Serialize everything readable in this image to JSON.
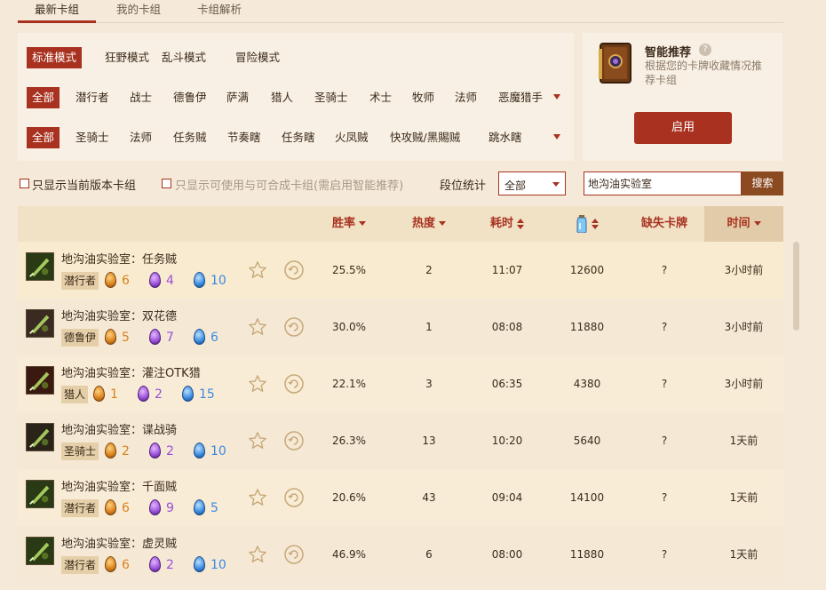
{
  "tabs": [
    "最新卡组",
    "我的卡组",
    "卡组解析"
  ],
  "modes": [
    "标准模式",
    "狂野模式",
    "乱斗模式",
    "冒险模式"
  ],
  "classes": [
    "全部",
    "潜行者",
    "战士",
    "德鲁伊",
    "萨满",
    "猎人",
    "圣骑士",
    "术士",
    "牧师",
    "法师",
    "恶魔猎手"
  ],
  "archetypes": [
    "全部",
    "圣骑士",
    "法师",
    "任务贼",
    "节奏瞎",
    "任务瞎",
    "火凤贼",
    "快攻贼/黑賜贼",
    "跳水瞎"
  ],
  "smart": {
    "title": "智能推荐",
    "help": "?",
    "desc": "根据您的卡牌收藏情况推荐卡组",
    "button": "启用"
  },
  "options": {
    "current_version": "只显示当前版本卡组",
    "craftable": "只显示可使用与可合成卡组(需启用智能推荐)",
    "rank_label": "段位统计",
    "rank_value": "全部",
    "search_value": "地沟油实验室",
    "search_button": "搜索"
  },
  "columns": {
    "winrate": "胜率",
    "popularity": "热度",
    "duration": "耗时",
    "missing": "缺失卡牌",
    "time": "时间"
  },
  "decks": [
    {
      "name": "地沟油实验室：任务贼",
      "class": "潜行者",
      "orange": "6",
      "purple": "4",
      "blue": "10",
      "winrate": "25.5%",
      "popularity": "2",
      "duration": "11:07",
      "dust": "12600",
      "missing": "?",
      "time": "3小时前"
    },
    {
      "name": "地沟油实验室：双花德",
      "class": "德鲁伊",
      "orange": "5",
      "purple": "7",
      "blue": "6",
      "winrate": "30.0%",
      "popularity": "1",
      "duration": "08:08",
      "dust": "11880",
      "missing": "?",
      "time": "3小时前"
    },
    {
      "name": "地沟油实验室：灌注OTK猎",
      "class": "猎人",
      "orange": "1",
      "purple": "2",
      "blue": "15",
      "winrate": "22.1%",
      "popularity": "3",
      "duration": "06:35",
      "dust": "4380",
      "missing": "?",
      "time": "3小时前"
    },
    {
      "name": "地沟油实验室：谍战骑",
      "class": "圣骑士",
      "orange": "2",
      "purple": "2",
      "blue": "10",
      "winrate": "26.3%",
      "popularity": "13",
      "duration": "10:20",
      "dust": "5640",
      "missing": "?",
      "time": "1天前"
    },
    {
      "name": "地沟油实验室：千面贼",
      "class": "潜行者",
      "orange": "6",
      "purple": "9",
      "blue": "5",
      "winrate": "20.6%",
      "popularity": "43",
      "duration": "09:04",
      "dust": "14100",
      "missing": "?",
      "time": "1天前"
    },
    {
      "name": "地沟油实验室：虚灵贼",
      "class": "潜行者",
      "orange": "6",
      "purple": "2",
      "blue": "10",
      "winrate": "46.9%",
      "popularity": "6",
      "duration": "08:00",
      "dust": "11880",
      "missing": "?",
      "time": "1天前"
    }
  ]
}
